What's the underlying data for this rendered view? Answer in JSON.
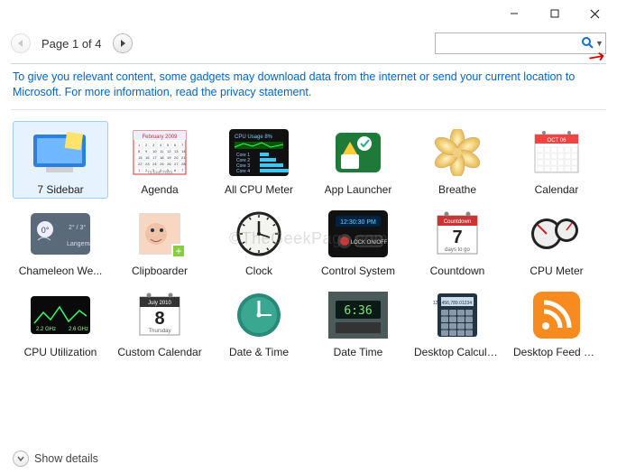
{
  "titlebar": {
    "minimize": "—",
    "maximize": "□",
    "close": "✕"
  },
  "toolbar": {
    "page_label": "Page 1 of 4"
  },
  "search": {
    "placeholder": ""
  },
  "banner": {
    "text": "To give you relevant content, some gadgets may download data from the internet or send your current location to Microsoft. For more information, read the privacy statement."
  },
  "watermark": "©TheGeekPage.com",
  "footer": {
    "show_details": "Show details"
  },
  "gadgets": [
    {
      "label": "7 Sidebar",
      "icon_key": "seven-sidebar",
      "selected": true
    },
    {
      "label": "Agenda",
      "icon_key": "agenda"
    },
    {
      "label": "All CPU Meter",
      "icon_key": "all-cpu"
    },
    {
      "label": "App Launcher",
      "icon_key": "app-launcher"
    },
    {
      "label": "Breathe",
      "icon_key": "breathe"
    },
    {
      "label": "Calendar",
      "icon_key": "calendar"
    },
    {
      "label": "Chameleon We...",
      "icon_key": "chameleon"
    },
    {
      "label": "Clipboarder",
      "icon_key": "clipboarder"
    },
    {
      "label": "Clock",
      "icon_key": "clock"
    },
    {
      "label": "Control System",
      "icon_key": "control-system"
    },
    {
      "label": "Countdown",
      "icon_key": "countdown",
      "badge_top": "Countdown",
      "badge_big": "7",
      "badge_bottom": "days to go"
    },
    {
      "label": "CPU Meter",
      "icon_key": "cpu-meter"
    },
    {
      "label": "CPU Utilization",
      "icon_key": "cpu-util"
    },
    {
      "label": "Custom Calendar",
      "icon_key": "custom-calendar",
      "badge_top": "July 2010",
      "badge_big": "8",
      "badge_bottom": "Thursday"
    },
    {
      "label": "Date & Time",
      "icon_key": "date-time"
    },
    {
      "label": "Date Time",
      "icon_key": "date-time-2"
    },
    {
      "label": "Desktop Calcula...",
      "icon_key": "desktop-calc"
    },
    {
      "label": "Desktop Feed R...",
      "icon_key": "desktop-feed"
    }
  ]
}
